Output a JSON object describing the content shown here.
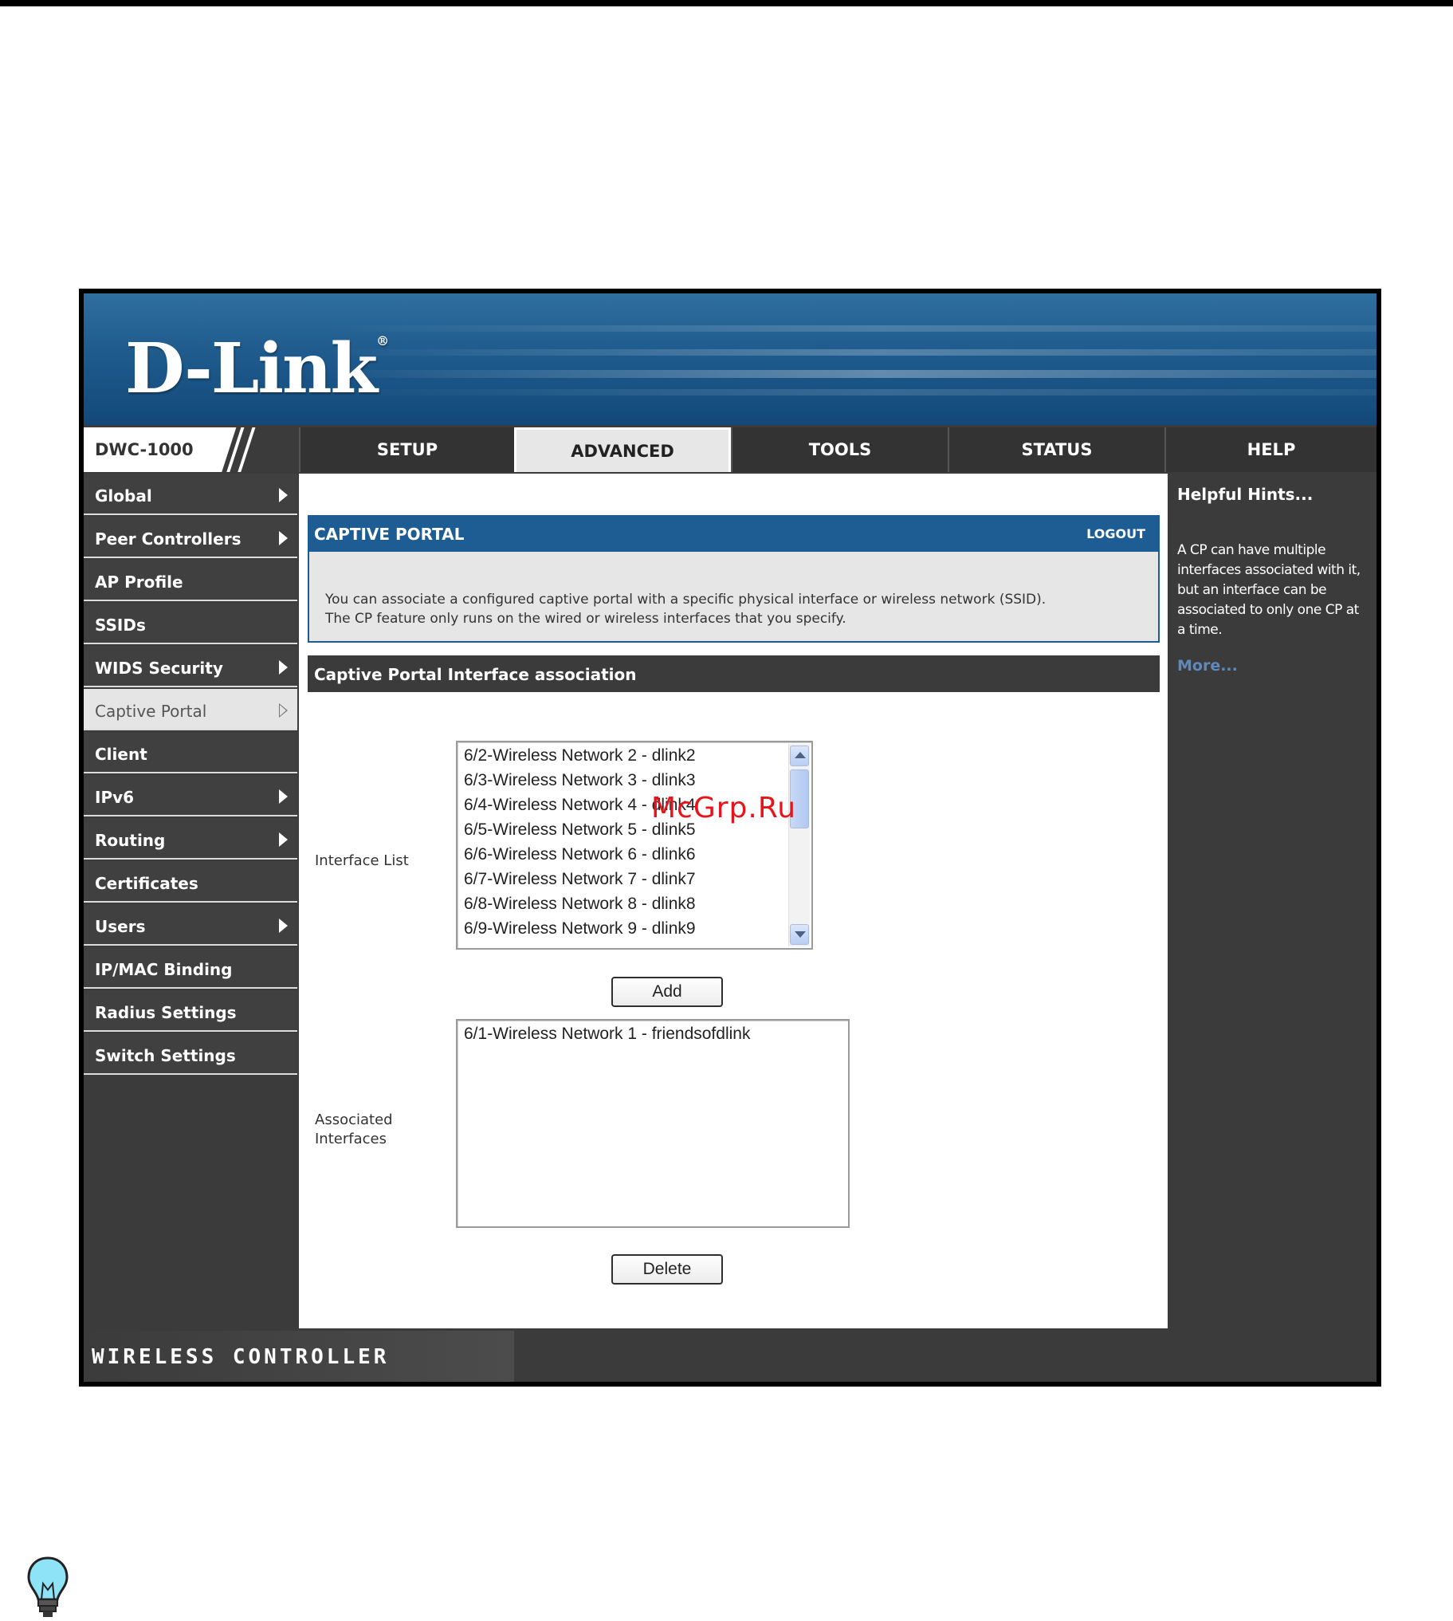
{
  "brand": {
    "logo": "D-Link",
    "registered": "®"
  },
  "nav": {
    "model": "DWC-1000",
    "tabs": [
      "SETUP",
      "ADVANCED",
      "TOOLS",
      "STATUS",
      "HELP"
    ],
    "active_tab": "ADVANCED"
  },
  "sidebar": {
    "items": [
      {
        "label": "Global",
        "arrow": true
      },
      {
        "label": "Peer Controllers",
        "arrow": true
      },
      {
        "label": "AP Profile",
        "arrow": false
      },
      {
        "label": "SSIDs",
        "arrow": false
      },
      {
        "label": "WIDS Security",
        "arrow": true
      },
      {
        "label": "Captive Portal",
        "arrow": true,
        "active": true
      },
      {
        "label": "Client",
        "arrow": false
      },
      {
        "label": "IPv6",
        "arrow": true
      },
      {
        "label": "Routing",
        "arrow": true
      },
      {
        "label": "Certificates",
        "arrow": false
      },
      {
        "label": "Users",
        "arrow": true
      },
      {
        "label": "IP/MAC Binding",
        "arrow": false
      },
      {
        "label": "Radius Settings",
        "arrow": false
      },
      {
        "label": "Switch Settings",
        "arrow": false
      }
    ]
  },
  "main": {
    "header_title": "CAPTIVE PORTAL",
    "logout": "LOGOUT",
    "description_line1": "You can associate a configured captive portal with a specific physical interface or wireless network (SSID).",
    "description_line2": "The CP feature only runs on the wired or wireless interfaces that you specify.",
    "section_title": "Captive Portal Interface association",
    "interface_list_label": "Interface List",
    "interface_list": [
      "6/2-Wireless Network 2 - dlink2",
      "6/3-Wireless Network 3 - dlink3",
      "6/4-Wireless Network 4 - dlink4",
      "6/5-Wireless Network 5 - dlink5",
      "6/6-Wireless Network 6 - dlink6",
      "6/7-Wireless Network 7 - dlink7",
      "6/8-Wireless Network 8 - dlink8",
      "6/9-Wireless Network 9 - dlink9"
    ],
    "add_button": "Add",
    "associated_label_line1": "Associated",
    "associated_label_line2": "Interfaces",
    "associated_list": [
      "6/1-Wireless Network 1 - friendsofdlink"
    ],
    "delete_button": "Delete"
  },
  "help": {
    "title": "Helpful Hints...",
    "body": "A CP can have multiple interfaces associated with it, but an interface can be associated to only one CP at a time.",
    "more": "More..."
  },
  "footer": {
    "title": "WIRELESS CONTROLLER"
  },
  "watermark": "McGrp.Ru",
  "colors": {
    "banner": "#1f5b8d",
    "header_blue": "#1d5d93",
    "dark_gray": "#3b3b3b",
    "watermark": "#e8141b",
    "link": "#5d89bd"
  }
}
